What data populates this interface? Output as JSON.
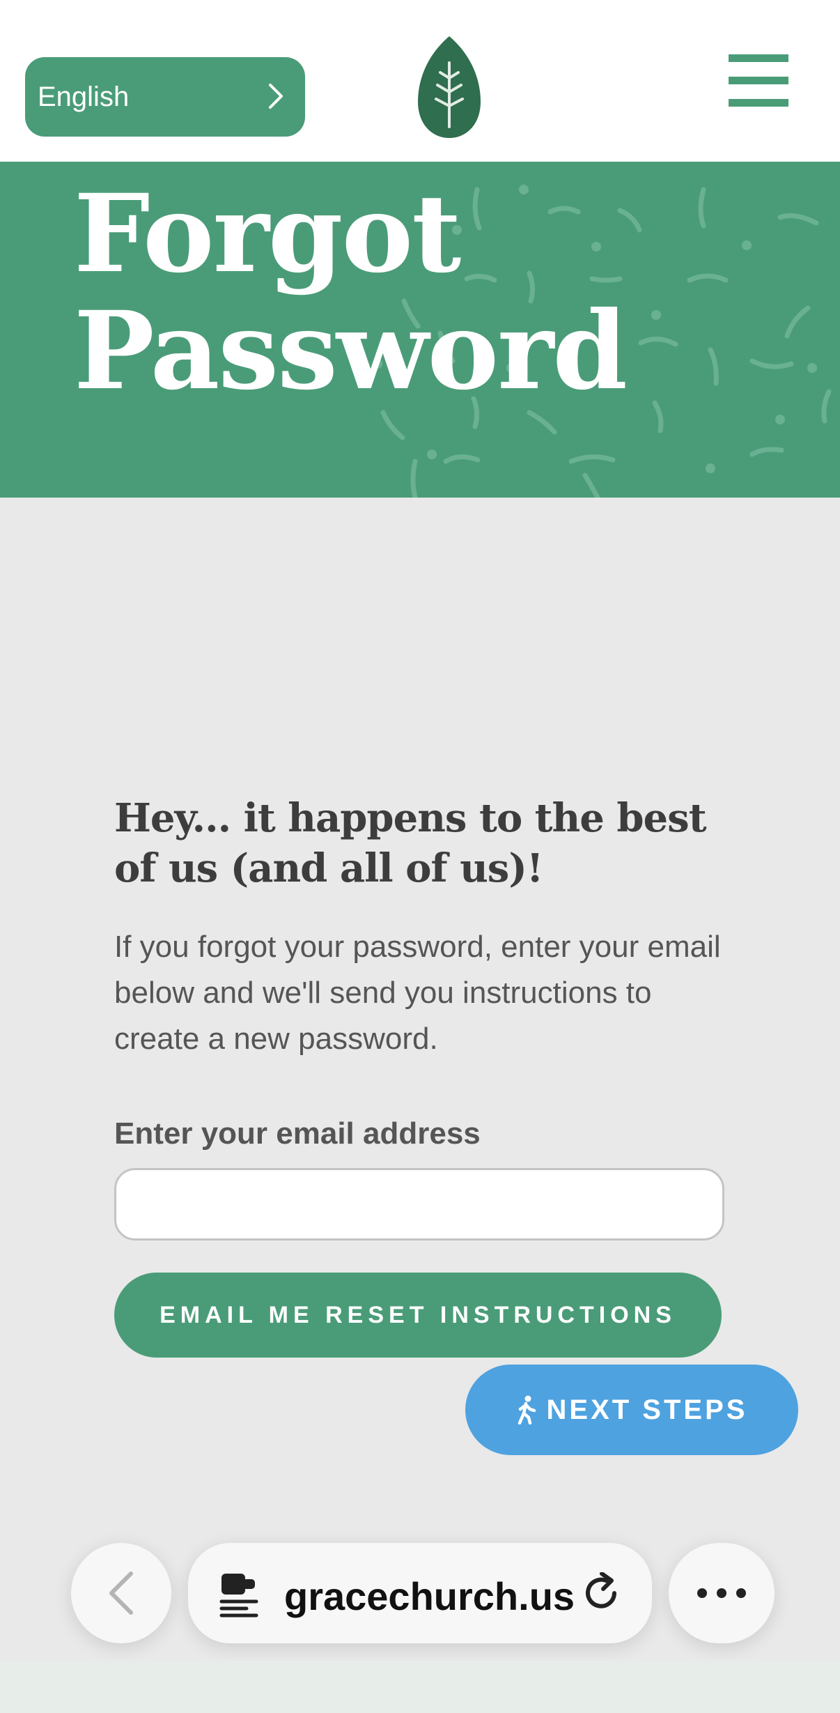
{
  "header": {
    "language_label": "English",
    "icons": {
      "language_chevron": "chevron-right-icon",
      "logo": "leaf-logo",
      "menu": "hamburger-menu-icon"
    }
  },
  "hero": {
    "title_line1": "Forgot",
    "title_line2": "Password"
  },
  "form": {
    "heading": "Hey... it happens to the best of us (and all of us)!",
    "description": "If you forgot your password, enter your email below and we'll send you instructions to create a new password.",
    "email_label": "Enter your email address",
    "email_value": "",
    "submit_label": "EMAIL ME RESET INSTRUCTIONS"
  },
  "floating": {
    "next_steps_label": "NEXT STEPS",
    "icon": "walking-person-icon"
  },
  "browser": {
    "url": "gracechurch.us",
    "icons": {
      "back": "back-arrow-icon",
      "page": "page-settings-icon",
      "reload": "reload-icon",
      "more": "more-dots-icon"
    }
  },
  "colors": {
    "brand_green": "#4a9c78",
    "logo_green": "#2f6e4e",
    "next_steps_blue": "#4ea2e0",
    "page_bg": "#e9e9e9"
  }
}
